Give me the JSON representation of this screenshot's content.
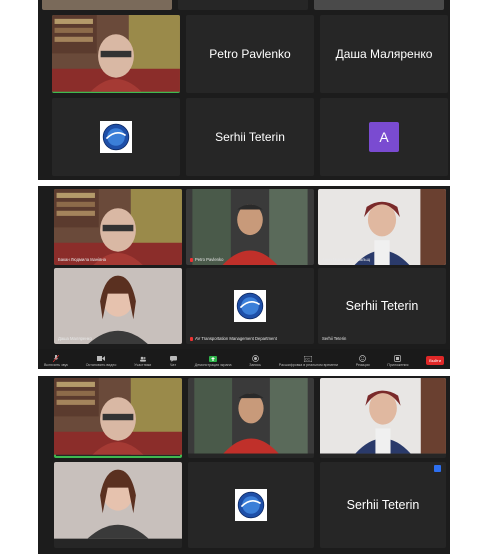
{
  "screenshot1": {
    "tiles": [
      {
        "name": ""
      },
      {
        "name": "Petro Pavlenko"
      },
      {
        "name": "Даша Маляренко"
      },
      {
        "name": ""
      },
      {
        "name": "Serhii Teterin"
      },
      {
        "name": "",
        "avatar_letter": "A"
      }
    ]
  },
  "screenshot2": {
    "tiles": [
      {
        "label": "Бакан Людмила Іванівна"
      },
      {
        "label": "Petro Pavlenko"
      },
      {
        "label": "Анна Михайлівна Вальщ"
      },
      {
        "label": "Даша Маляренко"
      },
      {
        "label": "AV Transportation Management Department"
      },
      {
        "label": "Serhii Teterin",
        "name": "Serhii Teterin"
      }
    ],
    "toolbar": {
      "items": [
        {
          "label": "Включить звук",
          "icon": "mic-icon"
        },
        {
          "label": "Остановить видео",
          "icon": "camera-icon"
        },
        {
          "label": "Участники",
          "icon": "participants-icon"
        },
        {
          "label": "Чат",
          "icon": "chat-icon"
        },
        {
          "label": "Демонстрация экрана",
          "icon": "share-screen-icon"
        },
        {
          "label": "Запись",
          "icon": "record-icon"
        },
        {
          "label": "Расшифровка в реальном времени",
          "icon": "captions-icon"
        },
        {
          "label": "Реакции",
          "icon": "reactions-icon"
        },
        {
          "label": "Приложения",
          "icon": "apps-icon"
        }
      ],
      "end_label": "Выйти"
    }
  },
  "screenshot3": {
    "tiles": [
      {
        "name": ""
      },
      {
        "name": ""
      },
      {
        "name": ""
      },
      {
        "name": ""
      },
      {
        "name": ""
      },
      {
        "name": "Serhii Teterin"
      }
    ]
  },
  "colors": {
    "background": "#1c1c1c",
    "tile": "#262626",
    "active_speaker_border": "#3fb950",
    "avatar": "#7a4bd1",
    "end_button": "#e02828",
    "share_screen": "#2fb34a"
  }
}
